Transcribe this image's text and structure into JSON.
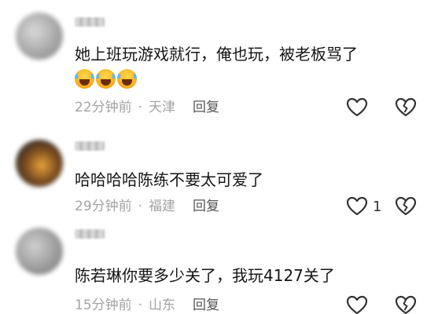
{
  "comments": [
    {
      "text": "她上班玩游戏就行，俺也玩，被老板骂了",
      "emojis": [
        "laughing-crying-emoji",
        "laughing-crying-emoji",
        "laughing-crying-emoji"
      ],
      "time": "22分钟前",
      "separator": "·",
      "location": "天津",
      "reply_label": "回复",
      "like_count": ""
    },
    {
      "text": "哈哈哈哈陈练不要太可爱了",
      "time": "29分钟前",
      "separator": "·",
      "location": "福建",
      "reply_label": "回复",
      "like_count": "1"
    },
    {
      "text": "陈若琳你要多少关了，我玩4127关了",
      "time": "15分钟前",
      "separator": "·",
      "location": "山东",
      "reply_label": "回复",
      "like_count": ""
    }
  ],
  "icons": {
    "like": "heart-outline-icon",
    "dislike": "broken-heart-icon"
  },
  "colors": {
    "text": "#151515",
    "meta": "#a3a3a3",
    "reply": "#555555",
    "icon": "#333333"
  }
}
